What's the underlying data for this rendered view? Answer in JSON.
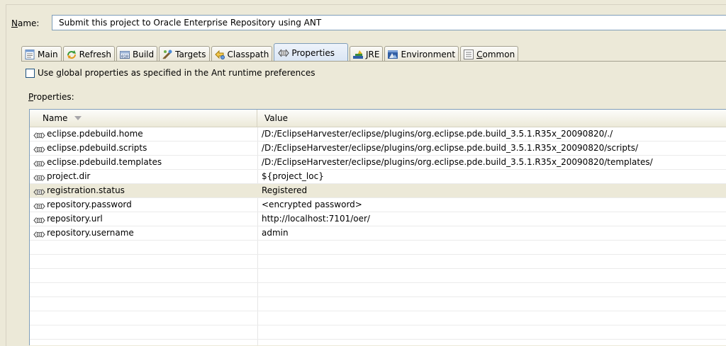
{
  "config": {
    "name_label_mnemonic": "N",
    "name_label_rest": "ame:",
    "name_value": "Submit this project to Oracle Enterprise Repository using ANT"
  },
  "tabs": [
    {
      "label_pre": "",
      "label_ul": "",
      "label": "Main",
      "icon": "main-icon",
      "active": false
    },
    {
      "label_pre": "",
      "label_ul": "",
      "label": "Refresh",
      "icon": "refresh-icon",
      "active": false
    },
    {
      "label_pre": "",
      "label_ul": "",
      "label": "Build",
      "icon": "build-icon",
      "active": false
    },
    {
      "label_pre": "",
      "label_ul": "",
      "label": "Targets",
      "icon": "targets-icon",
      "active": false
    },
    {
      "label_pre": "",
      "label_ul": "",
      "label": "Classpath",
      "icon": "classpath-icon",
      "active": false
    },
    {
      "label_pre": "",
      "label_ul": "",
      "label": "Properties",
      "icon": "properties-icon",
      "active": true
    },
    {
      "label_pre": "",
      "label_ul": "",
      "label": "JRE",
      "icon": "jre-icon",
      "active": false
    },
    {
      "label_pre": "",
      "label_ul": "",
      "label": "Environment",
      "icon": "environment-icon",
      "active": false
    },
    {
      "label_pre": "",
      "label_ul": "C",
      "label": "ommon",
      "icon": "common-icon",
      "active": false
    }
  ],
  "global": {
    "pre": "Use ",
    "ul": "g",
    "rest": "lobal properties as specified in the Ant runtime preferences",
    "checked": false
  },
  "properties_label": {
    "ul": "P",
    "rest": "roperties:"
  },
  "table": {
    "columns": [
      "Name",
      "Value"
    ],
    "rows": [
      {
        "name": "eclipse.pdebuild.home",
        "value": "/D:/EclipseHarvester/eclipse/plugins/org.eclipse.pde.build_3.5.1.R35x_20090820/./",
        "highlight": false
      },
      {
        "name": "eclipse.pdebuild.scripts",
        "value": "/D:/EclipseHarvester/eclipse/plugins/org.eclipse.pde.build_3.5.1.R35x_20090820/scripts/",
        "highlight": false
      },
      {
        "name": "eclipse.pdebuild.templates",
        "value": "/D:/EclipseHarvester/eclipse/plugins/org.eclipse.pde.build_3.5.1.R35x_20090820/templates/",
        "highlight": false
      },
      {
        "name": "project.dir",
        "value": "${project_loc}",
        "highlight": false
      },
      {
        "name": "registration.status",
        "value": "Registered",
        "highlight": true
      },
      {
        "name": "repository.password",
        "value": "<encrypted password>",
        "highlight": false
      },
      {
        "name": "repository.url",
        "value": "http://localhost:7101/oer/",
        "highlight": false
      },
      {
        "name": "repository.username",
        "value": "admin",
        "highlight": false
      }
    ],
    "empty_rows": 7
  },
  "colors": {
    "background": "#ece9d8",
    "border": "#7f9db9",
    "highlight": "#ece9d8"
  }
}
